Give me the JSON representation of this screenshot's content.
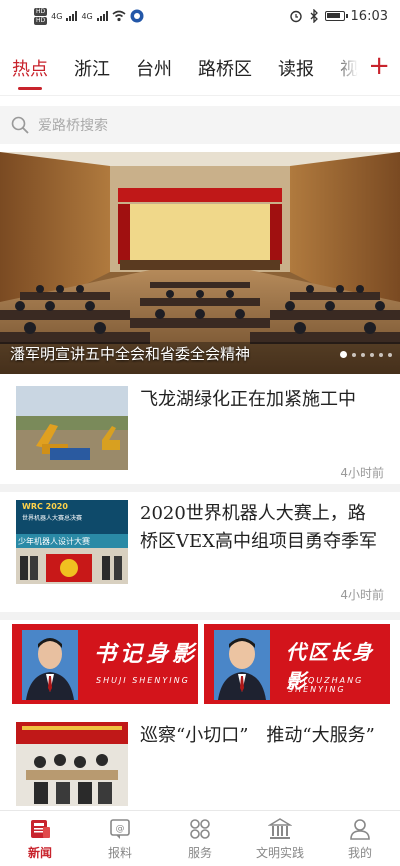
{
  "status_bar": {
    "sim1": "HD",
    "sim2": "HD",
    "network1": "4G",
    "network2": "4G",
    "time": "16:03"
  },
  "tabs": [
    {
      "label": "热点",
      "active": true
    },
    {
      "label": "浙江",
      "active": false
    },
    {
      "label": "台州",
      "active": false
    },
    {
      "label": "路桥区",
      "active": false
    },
    {
      "label": "读报",
      "active": false
    },
    {
      "label": "视",
      "active": false
    }
  ],
  "add_channel_icon": "plus-icon",
  "search": {
    "placeholder": "爱路桥搜索"
  },
  "banner": {
    "caption": "潘军明宣讲五中全会和省委全会精神",
    "slide_count": 6,
    "active_slide": 1
  },
  "news": [
    {
      "title": "飞龙湖绿化正在加紧施工中",
      "time": "4小时前"
    },
    {
      "title": "2020世界机器人大赛上，路桥区VEX高中组项目勇夺季军",
      "time": "4小时前",
      "thumb_text": {
        "line1": "WRC 2020",
        "line2": "世界机器人大赛总决赛",
        "line3": "少年机器人设计大赛"
      }
    },
    {
      "title": "巡察“小切口”　推动“大服务”",
      "time": ""
    }
  ],
  "leaders": [
    {
      "title": "书记身影",
      "subtitle": "SHUJI SHENYING"
    },
    {
      "title": "代区长身影",
      "subtitle": "DAIQUZHANG SHENYING"
    }
  ],
  "bottom_nav": [
    {
      "label": "新闻",
      "icon": "newspaper-icon",
      "active": true
    },
    {
      "label": "报料",
      "icon": "report-icon",
      "active": false
    },
    {
      "label": "服务",
      "icon": "services-icon",
      "active": false
    },
    {
      "label": "文明实践",
      "icon": "building-icon",
      "active": false
    },
    {
      "label": "我的",
      "icon": "user-icon",
      "active": false
    }
  ],
  "colors": {
    "accent": "#c8232c",
    "leader_banner": "#d3141b"
  }
}
